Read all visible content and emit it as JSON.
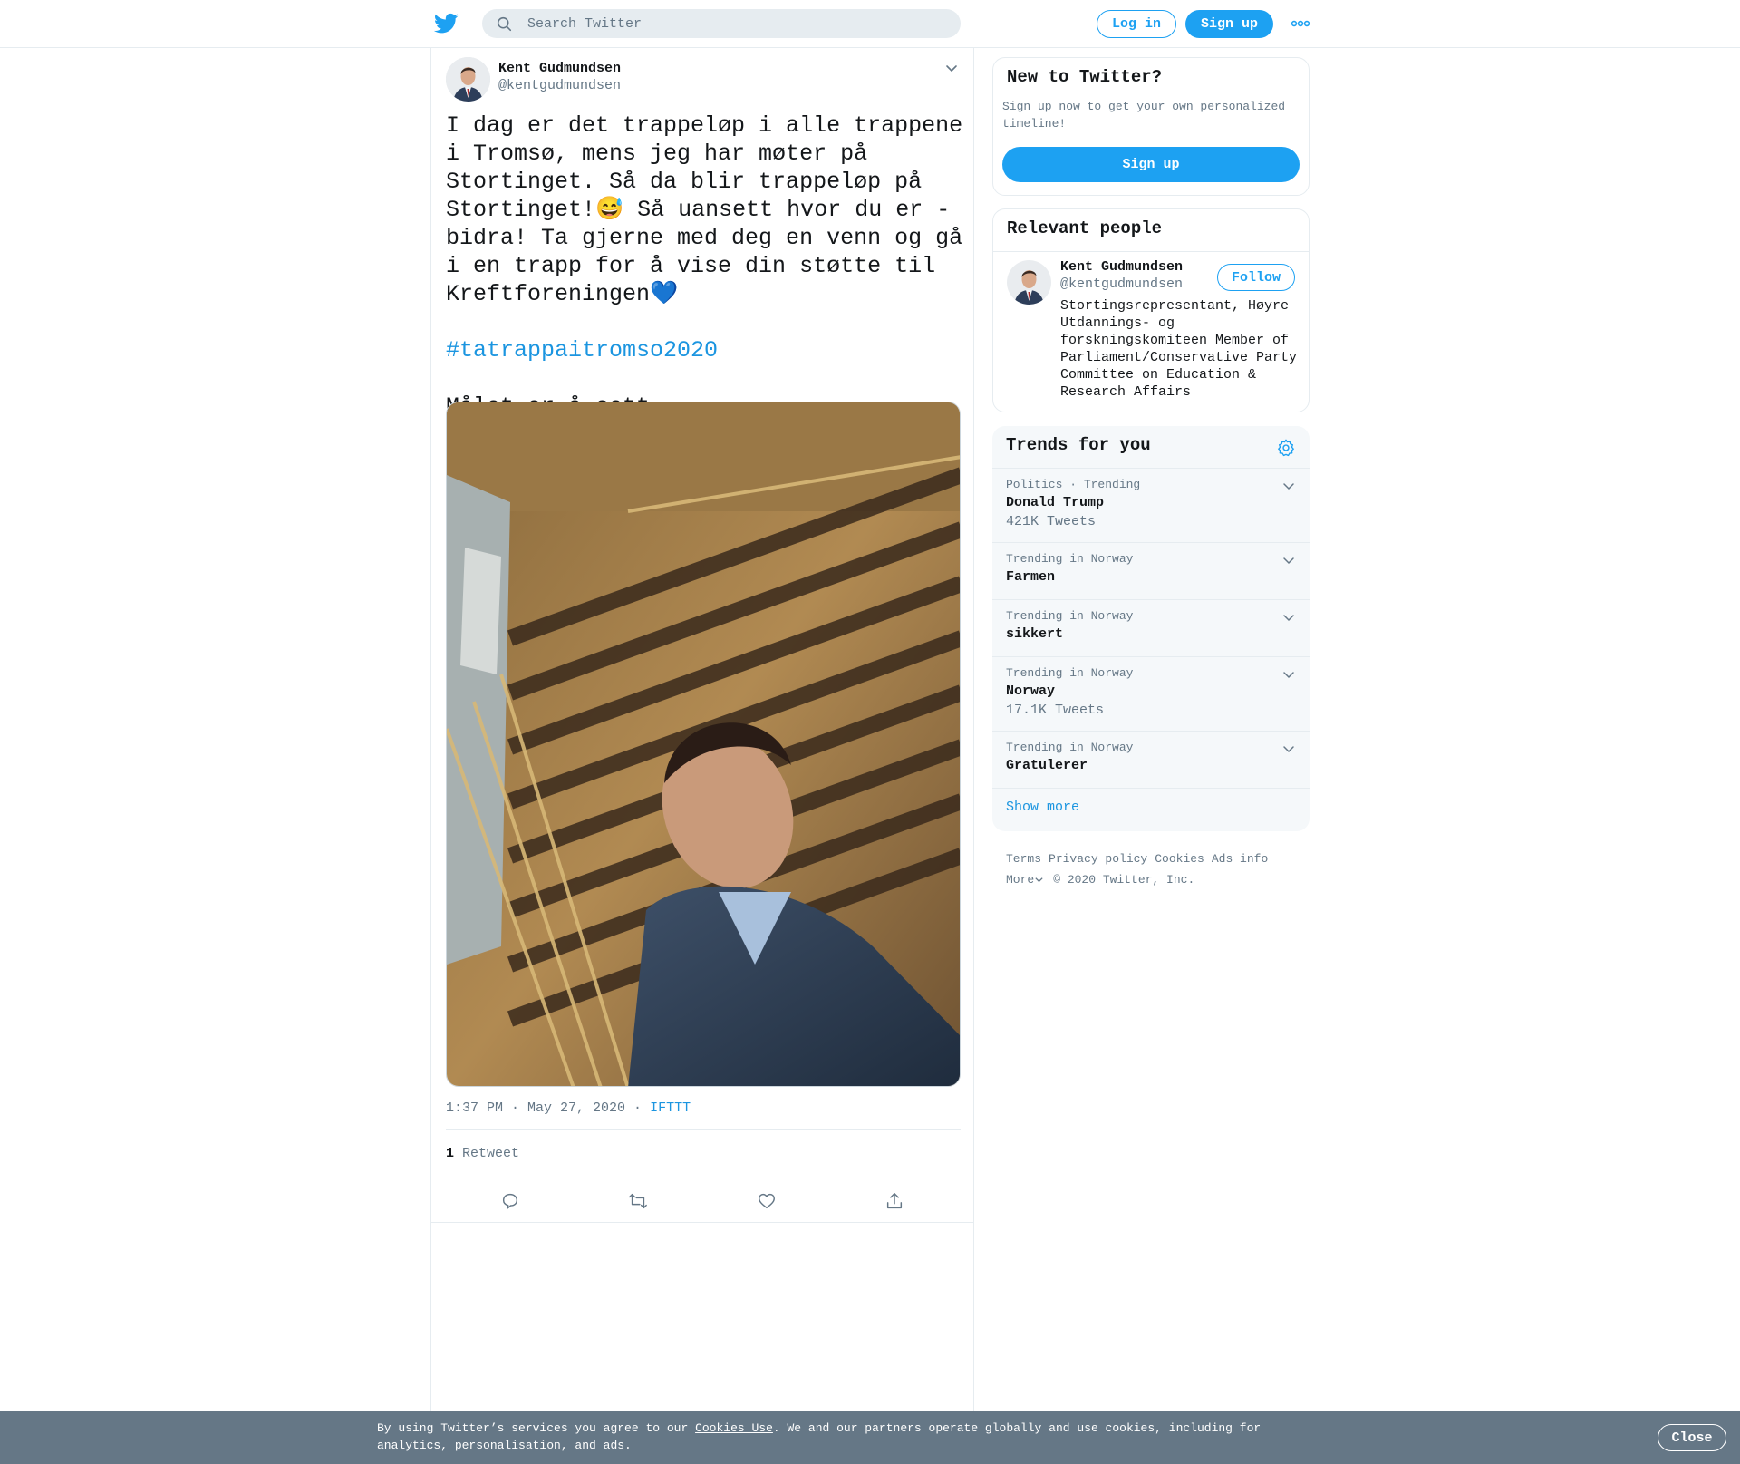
{
  "header": {
    "search_placeholder": "Search Twitter",
    "login_label": "Log in",
    "signup_label": "Sign up",
    "brand_color": "#1da1f2"
  },
  "tweet": {
    "author_name": "Kent Gudmundsen",
    "author_handle": "@kentgudmundsen",
    "text_main": "I dag er det trappeløp i alle trappene i Tromsø, mens jeg har møter på Stortinget. Så da blir trappeløp på Stortinget!😅 Så uansett hvor du er - bidra! Ta gjerne med deg en venn og gå i en trapp for å vise din støtte til Kreftforeningen💙",
    "hashtag": "#tatrappaitromso2020",
    "text_tail": "Målet er å sett…",
    "timestamp": "1:37 PM · May 27, 2020",
    "separator": " · ",
    "source": "IFTTT",
    "retweet_count": "1",
    "retweet_label": "Retweet",
    "actions": [
      "reply-icon",
      "retweet-icon",
      "like-icon",
      "share-icon"
    ]
  },
  "sidebar": {
    "new_to_twitter": {
      "title": "New to Twitter?",
      "subtitle": "Sign up now to get your own personalized timeline!",
      "button": "Sign up"
    },
    "relevant_people": {
      "title": "Relevant people",
      "person": {
        "name": "Kent Gudmundsen",
        "handle": "@kentgudmundsen",
        "follow_label": "Follow",
        "bio": "Stortingsrepresentant, Høyre Utdannings- og forskningskomiteen Member of Parliament/Conservative Party Committee on Education & Research Affairs"
      }
    },
    "trends": {
      "title": "Trends for you",
      "items": [
        {
          "context": "Politics · Trending",
          "name": "Donald Trump",
          "count": "421K Tweets"
        },
        {
          "context": "Trending in Norway",
          "name": "Farmen",
          "count": ""
        },
        {
          "context": "Trending in Norway",
          "name": "sikkert",
          "count": ""
        },
        {
          "context": "Trending in Norway",
          "name": "Norway",
          "count": "17.1K Tweets"
        },
        {
          "context": "Trending in Norway",
          "name": "Gratulerer",
          "count": ""
        }
      ],
      "show_more": "Show more"
    },
    "footer": {
      "links": [
        "Terms",
        "Privacy policy",
        "Cookies",
        "Ads info"
      ],
      "more": "More",
      "copyright": "© 2020 Twitter, Inc."
    }
  },
  "cookie_bar": {
    "text_before": "By using Twitter’s services you agree to our ",
    "link": "Cookies Use",
    "text_after": ". We and our partners operate globally and use cookies, including for analytics, personalisation, and ads.",
    "close_label": "Close"
  }
}
